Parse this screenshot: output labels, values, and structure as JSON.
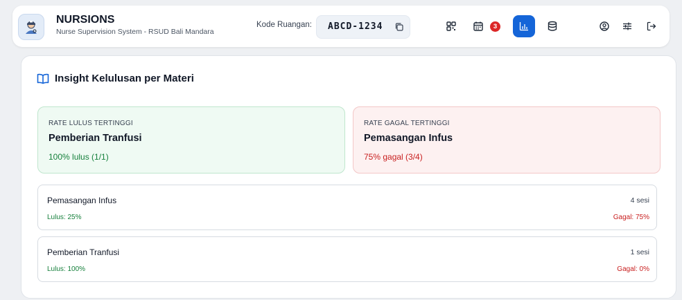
{
  "header": {
    "app_title": "NURSIONS",
    "app_subtitle": "Nurse Supervision System - RSUD Bali Mandara",
    "room_label": "Kode Ruangan:",
    "room_code": "ABCD-1234",
    "notification_count": "3",
    "nav_icons": [
      "qr-code-icon",
      "calendar-icon",
      "bar-chart-icon",
      "database-icon",
      "user-circle-icon",
      "sliders-icon",
      "logout-icon"
    ],
    "active_nav": "bar-chart-icon"
  },
  "main": {
    "title": "Insight Kelulusan per Materi",
    "highest_pass": {
      "caption": "RATE LULUS TERTINGGI",
      "name": "Pemberian Tranfusi",
      "rate": "100% lulus (1/1)"
    },
    "highest_fail": {
      "caption": "RATE GAGAL TERTINGGI",
      "name": "Pemasangan Infus",
      "rate": "75% gagal (3/4)"
    },
    "materials": [
      {
        "name": "Pemasangan Infus",
        "sessions": "4 sesi",
        "pass": "Lulus: 25%",
        "fail": "Gagal: 75%"
      },
      {
        "name": "Pemberian Tranfusi",
        "sessions": "1 sesi",
        "pass": "Lulus: 100%",
        "fail": "Gagal: 0%"
      }
    ]
  },
  "colors": {
    "accent": "#1565d8",
    "pass": "#16803c",
    "fail": "#c81e1e",
    "badge": "#dc2626"
  }
}
